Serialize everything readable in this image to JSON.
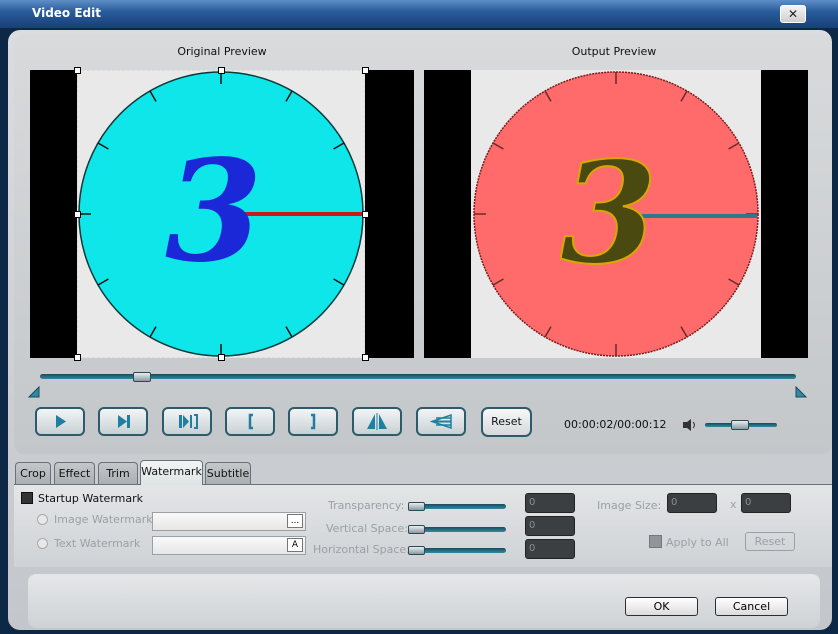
{
  "window": {
    "title": "Video Edit",
    "close_label": "✕"
  },
  "preview": {
    "original_label": "Original Preview",
    "output_label": "Output Preview",
    "clock_digit": "3",
    "original_colors": {
      "face": "#0ee6ea",
      "digit": "#1a28d8",
      "hand": "#c81a1a",
      "bg": "#e9e9e9"
    },
    "output_colors": {
      "face": "#ff6a6a",
      "digit": "#4a4a10",
      "hand": "#2a7a8a",
      "bg": "#e9e9e9"
    }
  },
  "seek": {
    "position_fraction": 0.14
  },
  "transport": {
    "buttons": [
      "play-icon",
      "next-frame-icon",
      "split-icon",
      "start-mark-icon",
      "end-mark-icon",
      "flip-icon",
      "rotate-icon"
    ],
    "reset_label": "Reset",
    "timecode": "00:00:02/00:00:12",
    "volume_fraction": 0.5
  },
  "tabs": [
    {
      "label": "Crop",
      "active": false
    },
    {
      "label": "Effect",
      "active": false
    },
    {
      "label": "Trim",
      "active": false
    },
    {
      "label": "Watermark",
      "active": true
    },
    {
      "label": "Subtitle",
      "active": false
    }
  ],
  "watermark": {
    "startup_label": "Startup Watermark",
    "image_label": "Image Watermark",
    "text_label": "Text Watermark",
    "browse_label": "...",
    "font_label": "A",
    "transparency_label": "Transparency:",
    "vertical_label": "Vertical Space:",
    "horizontal_label": "Horizontal Space:",
    "transparency_value": "0",
    "vertical_value": "0",
    "horizontal_value": "0",
    "image_size_label": "Image Size:",
    "size_w": "0",
    "size_x": "x",
    "size_h": "0",
    "apply_all_label": "Apply to All",
    "reset_label": "Reset"
  },
  "footer": {
    "ok_label": "OK",
    "cancel_label": "Cancel"
  }
}
